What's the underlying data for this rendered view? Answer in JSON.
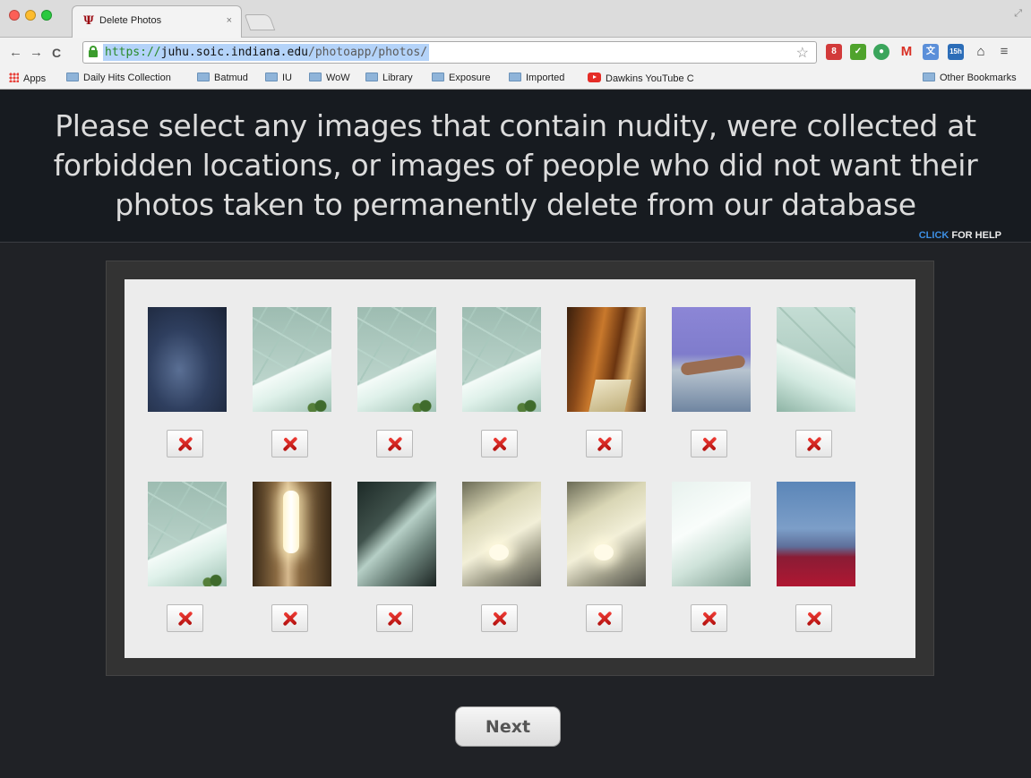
{
  "browser": {
    "tab_title": "Delete Photos",
    "tab_close": "×",
    "url_scheme": "https://",
    "url_host": "juhu.soic.indiana.edu",
    "url_path": "/photoapp/photos/",
    "bookmarks": [
      "Apps",
      "Daily Hits Collection",
      "Batmud",
      "IU",
      "WoW",
      "Library",
      "Exposure",
      "Imported",
      "Dawkins YouTube C"
    ],
    "other_bookmarks": "Other Bookmarks",
    "ext_badges": [
      "8",
      "15h"
    ]
  },
  "page": {
    "heading": "Please select any images that contain nudity, were collected at forbidden locations, or images of people who did not want their photos taken to permanently delete from our database",
    "help_click": "CLICK",
    "help_rest": " FOR HELP",
    "next_label": "Next"
  },
  "photos": [
    {
      "style": "dark"
    },
    {
      "style": "ceiling"
    },
    {
      "style": "ceiling"
    },
    {
      "style": "ceiling"
    },
    {
      "style": "wood"
    },
    {
      "style": "arm"
    },
    {
      "style": "ceiling2"
    },
    {
      "style": "ceiling"
    },
    {
      "style": "light"
    },
    {
      "style": "corner"
    },
    {
      "style": "yellow"
    },
    {
      "style": "yellow"
    },
    {
      "style": "white"
    },
    {
      "style": "blue"
    }
  ],
  "colors": {
    "page_bg": "#202226",
    "header_bg": "#171b20",
    "help_link": "#3d8fe3",
    "delete_x": "#d7261f"
  },
  "icons": {
    "delete": "delete-x-icon",
    "lock": "lock-icon",
    "star": "star-icon"
  }
}
